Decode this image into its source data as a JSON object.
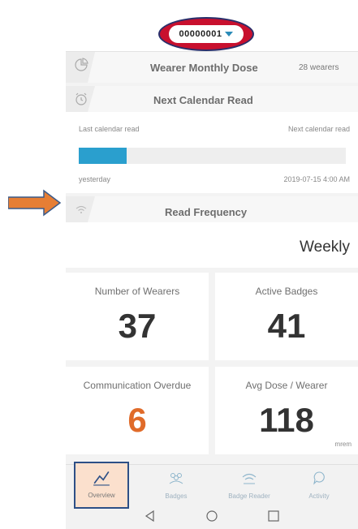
{
  "header": {
    "account_id": "00000001"
  },
  "monthly_dose": {
    "title": "Wearer Monthly Dose",
    "wearers": "28 wearers"
  },
  "calendar": {
    "title": "Next Calendar Read",
    "last_label": "Last calendar read",
    "next_label": "Next calendar read",
    "last_value": "yesterday",
    "next_value": "2019-07-15 4:00 AM",
    "progress_fraction": 0.18
  },
  "read_frequency": {
    "title": "Read Frequency",
    "value": "Weekly"
  },
  "stats": {
    "wearers_label": "Number of Wearers",
    "wearers_value": "37",
    "badges_label": "Active Badges",
    "badges_value": "41",
    "overdue_label": "Communication Overdue",
    "overdue_value": "6",
    "avg_label": "Avg Dose / Wearer",
    "avg_value": "118",
    "avg_unit": "mrem"
  },
  "nav": {
    "overview": "Overview",
    "badges": "Badges",
    "badge_reader": "Badge Reader",
    "activity": "Activity"
  },
  "colors": {
    "accent": "#2a9fce",
    "highlight_oval": "#c8102e",
    "overdue": "#e06b2a",
    "arrow": "#e67e35"
  },
  "icons": {
    "dose": "pie-chart-icon",
    "calendar": "alarm-clock-icon",
    "frequency": "wifi-icon",
    "overview": "trend-line-icon",
    "badges": "people-icon",
    "reader": "wifi-icon",
    "activity": "chat-bubble-icon"
  }
}
